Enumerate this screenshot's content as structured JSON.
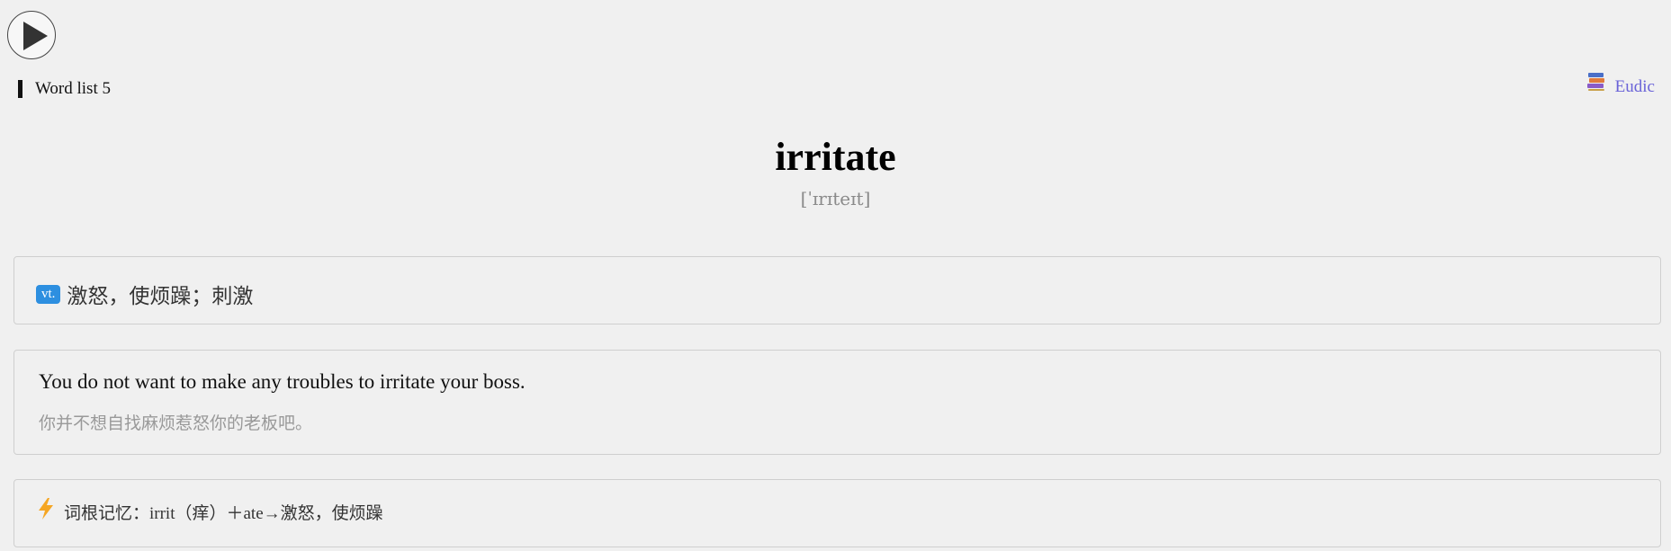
{
  "player": {
    "icon": "play-icon"
  },
  "header": {
    "wordlist_label": "Word list 5",
    "dict_link_label": "Eudic",
    "dict_icon": "books-icon"
  },
  "word": {
    "headword": "irritate",
    "phonetic": "[ˈɪrɪteɪt]"
  },
  "definition": {
    "pos": "vt.",
    "meaning": "激怒，使烦躁；刺激"
  },
  "example": {
    "english": "You do not want to make any troubles to irritate your boss.",
    "chinese": "你并不想自找麻烦惹怒你的老板吧。"
  },
  "memory": {
    "icon": "lightning-icon",
    "text": "词根记忆：irrit（痒）＋ate→激怒，使烦躁"
  },
  "colors": {
    "background": "#f0f0f0",
    "link": "#6a63d8",
    "pos_badge": "#2d8fe0",
    "bolt": "#f5a623",
    "muted_text": "#999999"
  }
}
